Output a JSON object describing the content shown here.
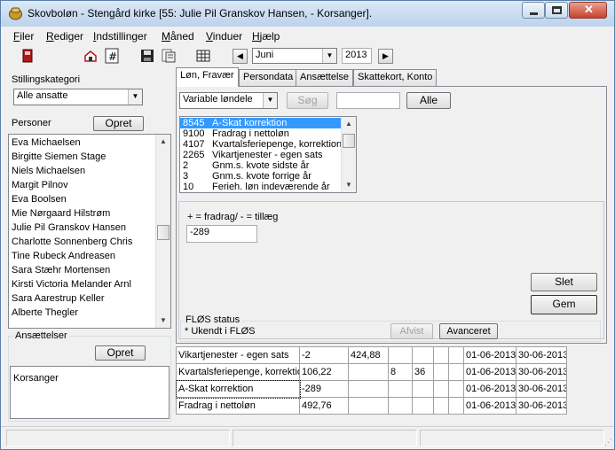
{
  "window": {
    "title": "Skovboløn - Stengård kirke [55: Julie Pil Granskov Hansen, - Korsanger]."
  },
  "menu": [
    {
      "key": "F",
      "rest": "iler"
    },
    {
      "key": "R",
      "rest": "ediger"
    },
    {
      "key": "I",
      "rest": "ndstillinger"
    },
    {
      "key": "M",
      "rest": "åned"
    },
    {
      "key": "V",
      "rest": "induer"
    },
    {
      "key": "H",
      "rest": "jælp"
    }
  ],
  "toolbar": {
    "month": "Juni",
    "year": "2013"
  },
  "left": {
    "stillingskategori_label": "Stillingskategori",
    "stillingskategori_value": "Alle ansatte",
    "personer_label": "Personer",
    "opret_label": "Opret",
    "persons": [
      "Eva Michaelsen",
      "Birgitte Siemen Stage",
      "Niels Michaelsen",
      "Margit Pilnov",
      "Eva Boolsen",
      "Mie Nørgaard Hilstrøm",
      "Julie Pil Granskov Hansen",
      "Charlotte Sonnenberg Chris",
      "Tine Rubeck Andreasen",
      "Sara Stæhr Mortensen",
      "Kirsti Victoria Melander Arnl",
      "Sara Aarestrup Keller",
      "Alberte Thegler"
    ],
    "ansaettelser_label": "Ansættelser",
    "ansaettelser_opret": "Opret",
    "ansaettelser": [
      "Korsanger"
    ]
  },
  "tabs": [
    {
      "label": "Løn, Fravær",
      "active": true
    },
    {
      "label": "Persondata",
      "active": false
    },
    {
      "label": "Ansættelse",
      "active": false
    },
    {
      "label": "Skattekort, Konto",
      "active": false
    }
  ],
  "lon": {
    "filter_value": "Variable løndele",
    "sog_label": "Søg",
    "search_value": "",
    "alle_label": "Alle",
    "codes": [
      {
        "code": "8545",
        "name": "A-Skat korrektion",
        "selected": true
      },
      {
        "code": "9100",
        "name": "Fradrag i nettoløn",
        "selected": false
      },
      {
        "code": "4107",
        "name": "Kvartalsferiepenge, korrektion",
        "selected": false
      },
      {
        "code": "2265",
        "name": "Vikartjenester - egen sats",
        "selected": false
      },
      {
        "code": "2",
        "name": "Gnm.s. kvote sidste år",
        "selected": false
      },
      {
        "code": "3",
        "name": "Gnm.s. kvote forrige år",
        "selected": false
      },
      {
        "code": "10",
        "name": "Ferieh. løn indeværende år",
        "selected": false
      }
    ],
    "hint": "+ = fradrag/ - = tillæg",
    "amount": "-289",
    "slet_label": "Slet",
    "gem_label": "Gem",
    "flos_title": "FLØS status",
    "flos_status": "* Ukendt i FLØS",
    "afvist_label": "Afvist",
    "avanceret_label": "Avanceret"
  },
  "grid": {
    "rows": [
      [
        "Vikartjenester - egen sats",
        "-2",
        "424,88",
        "",
        "",
        "",
        "",
        "01-06-2013",
        "30-06-2013"
      ],
      [
        "Kvartalsferiepenge, korrektion",
        "106,22",
        "",
        "8",
        "36",
        "",
        "",
        "01-06-2013",
        "30-06-2013"
      ],
      [
        "A-Skat korrektion",
        "-289",
        "",
        "",
        "",
        "",
        "",
        "01-06-2013",
        "30-06-2013"
      ],
      [
        "Fradrag i nettoløn",
        "492,76",
        "",
        "",
        "",
        "",
        "",
        "01-06-2013",
        "30-06-2013"
      ]
    ]
  }
}
